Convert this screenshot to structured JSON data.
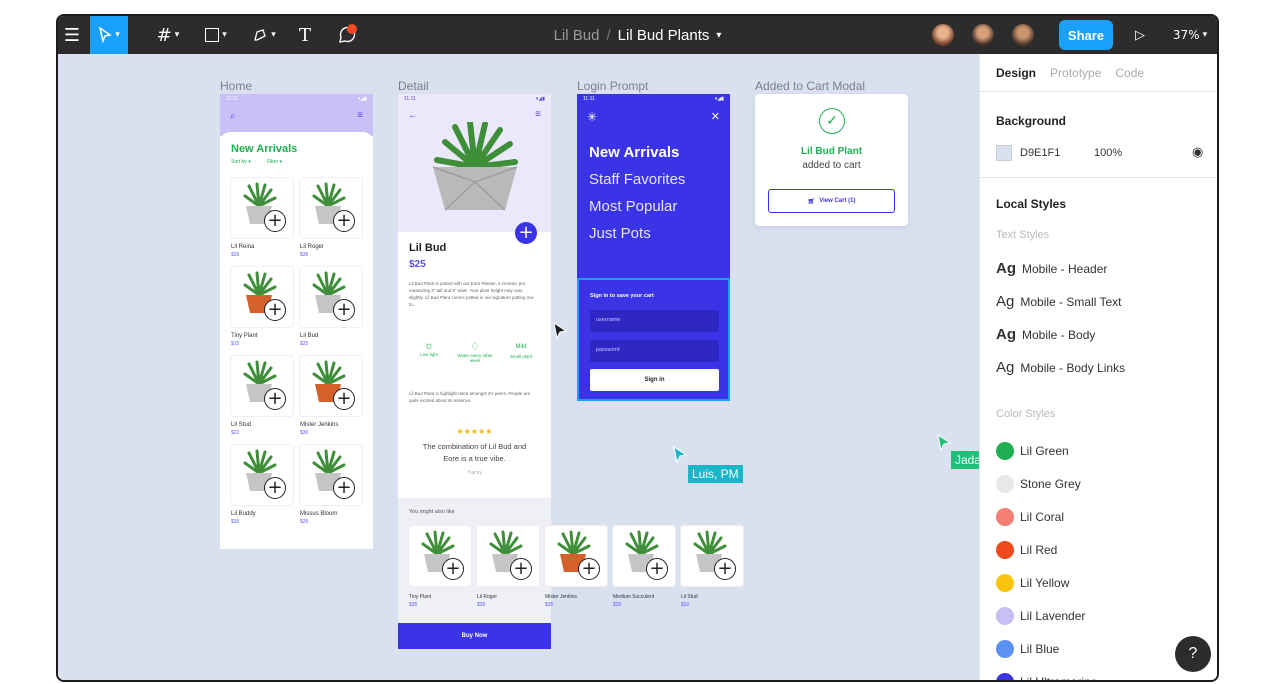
{
  "toolbar": {
    "project": "Lil Bud",
    "separator": "/",
    "file": "Lil Bud Plants",
    "share": "Share",
    "zoom": "37%",
    "text_tool": "T"
  },
  "frames": {
    "home": {
      "label": "Home",
      "title": "New Arrivals",
      "sort": "Sort by ▾",
      "filter": "Filter ▾",
      "plants": [
        {
          "name": "Lil Reina",
          "price": "$35"
        },
        {
          "name": "Lil Roger",
          "price": "$35"
        },
        {
          "name": "Tiny Plant",
          "price": "$15"
        },
        {
          "name": "Lil Bud",
          "price": "$25"
        },
        {
          "name": "Lil Stud",
          "price": "$22"
        },
        {
          "name": "Mister Jenkins",
          "price": "$30"
        },
        {
          "name": "Lil Buddy",
          "price": "$35"
        },
        {
          "name": "Missus Bloom",
          "price": "$25"
        }
      ]
    },
    "detail": {
      "label": "Detail",
      "name": "Lil Bud",
      "price": "$25",
      "description": "Lil Bud Plant is potted with our Eore Planter, a ceramic pot measuring 3\" tall and 5\" wide. Your plant height may vary slightly. Lil Bud Plant comes potted in our signature potting mix to...",
      "icons": [
        {
          "label": "Low light"
        },
        {
          "label": "Water every other week"
        },
        {
          "label": "Small plant",
          "badge": "Mild"
        }
      ],
      "blurb": "Lil Bud Plant is highlight rated amongst it's peers. People are quite excited about its essence.",
      "stars": "★★★★★",
      "quote": "The combination of Lil Bud and Eore is a true vibe.",
      "quote_author": "Tracey",
      "also_like": "You might also like",
      "related": [
        {
          "name": "Tiny Plant",
          "price": "$35"
        },
        {
          "name": "Lil Roger",
          "price": "$35"
        },
        {
          "name": "Mister Jenkins",
          "price": "$35"
        },
        {
          "name": "Medium Succulent",
          "price": "$35"
        },
        {
          "name": "Lil Stud",
          "price": "$32"
        }
      ],
      "buy": "Buy Now"
    },
    "login": {
      "label": "Login Prompt",
      "menu": [
        "New Arrivals",
        "Staff Favorites",
        "Most Popular",
        "Just Pots"
      ],
      "prompt": "Sign in to save your cart",
      "username_placeholder": "username",
      "password_placeholder": "password",
      "signin": "Sign in"
    },
    "cart": {
      "label": "Added to Cart Modal",
      "product": "Lil Bud Plant",
      "message": "added to cart",
      "button": "View Cart (1)"
    }
  },
  "cursors": {
    "luis": "Luis, PM",
    "jada": "Jada"
  },
  "panel": {
    "tabs": [
      "Design",
      "Prototype",
      "Code"
    ],
    "background_title": "Background",
    "bg_hex": "D9E1F1",
    "bg_opacity": "100%",
    "local_styles": "Local Styles",
    "text_styles_title": "Text Styles",
    "text_styles": [
      {
        "ag": "Ag",
        "name": "Mobile - Header",
        "bold": true
      },
      {
        "ag": "Ag",
        "name": "Mobile - Small Text",
        "bold": false
      },
      {
        "ag": "Ag",
        "name": "Mobile - Body",
        "bold": true
      },
      {
        "ag": "Ag",
        "name": "Mobile - Body Links",
        "bold": false
      }
    ],
    "color_styles_title": "Color Styles",
    "color_styles": [
      {
        "name": "Lil Green",
        "color": "#1fae52"
      },
      {
        "name": "Stone Grey",
        "color": "#e8e8e8"
      },
      {
        "name": "Lil Coral",
        "color": "#f57f73"
      },
      {
        "name": "Lil Red",
        "color": "#ef4a1c"
      },
      {
        "name": "Lil Yellow",
        "color": "#f9c50c"
      },
      {
        "name": "Lil Lavender",
        "color": "#c9bdf5"
      },
      {
        "name": "Lil Blue",
        "color": "#5b91f0"
      },
      {
        "name": "Lil Ultramarine",
        "color": "#3b33e6"
      }
    ],
    "help": "?"
  },
  "colors": {
    "accent": "#18a0fb",
    "ultramarine": "#3b33e6",
    "lavender": "#c8c0f6"
  }
}
